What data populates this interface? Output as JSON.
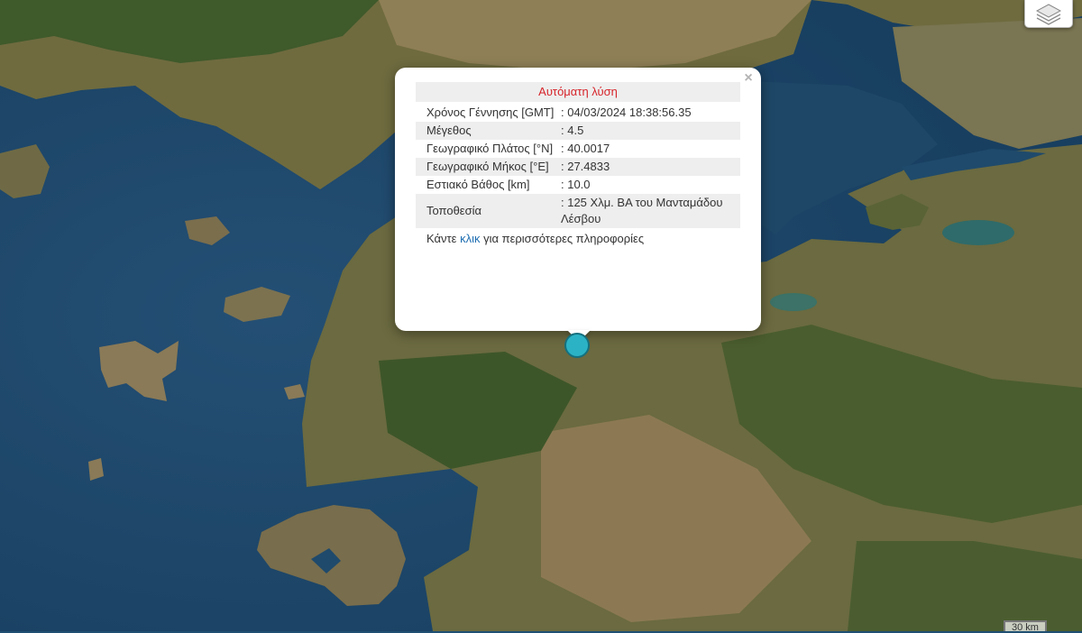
{
  "map": {
    "base": "satellite-imagery",
    "colors": {
      "sea": "#1f4f72",
      "land": "#6d6b3e",
      "forest": "#3f5a2a",
      "dry": "#8d7a55",
      "lake": "#2f6b6a"
    }
  },
  "controls": {
    "layers_icon": "layers-icon"
  },
  "popup": {
    "title": "Αυτόματη λύση",
    "close_symbol": "×",
    "rows": [
      {
        "label": "Χρόνος Γέννησης [GMT]",
        "value": ": 04/03/2024 18:38:56.35"
      },
      {
        "label": "Μέγεθος",
        "value": ": 4.5"
      },
      {
        "label": "Γεωγραφικό Πλάτος [°N]",
        "value": ": 40.0017"
      },
      {
        "label": "Γεωγραφικό Μήκος [°E]",
        "value": ": 27.4833"
      },
      {
        "label": "Εστιακό Βάθος [km]",
        "value": ": 10.0"
      },
      {
        "label": "Τοποθεσία",
        "value": ": 125 Χλμ. ΒΑ του Μανταμάδου Λέσβου"
      }
    ],
    "more_prefix": "Κάντε",
    "more_link": "κλικ",
    "more_suffix": "για περισσότερες πληροφορίες"
  },
  "marker": {
    "color": "#2bb3c5"
  },
  "scale": {
    "label": "30 km"
  }
}
